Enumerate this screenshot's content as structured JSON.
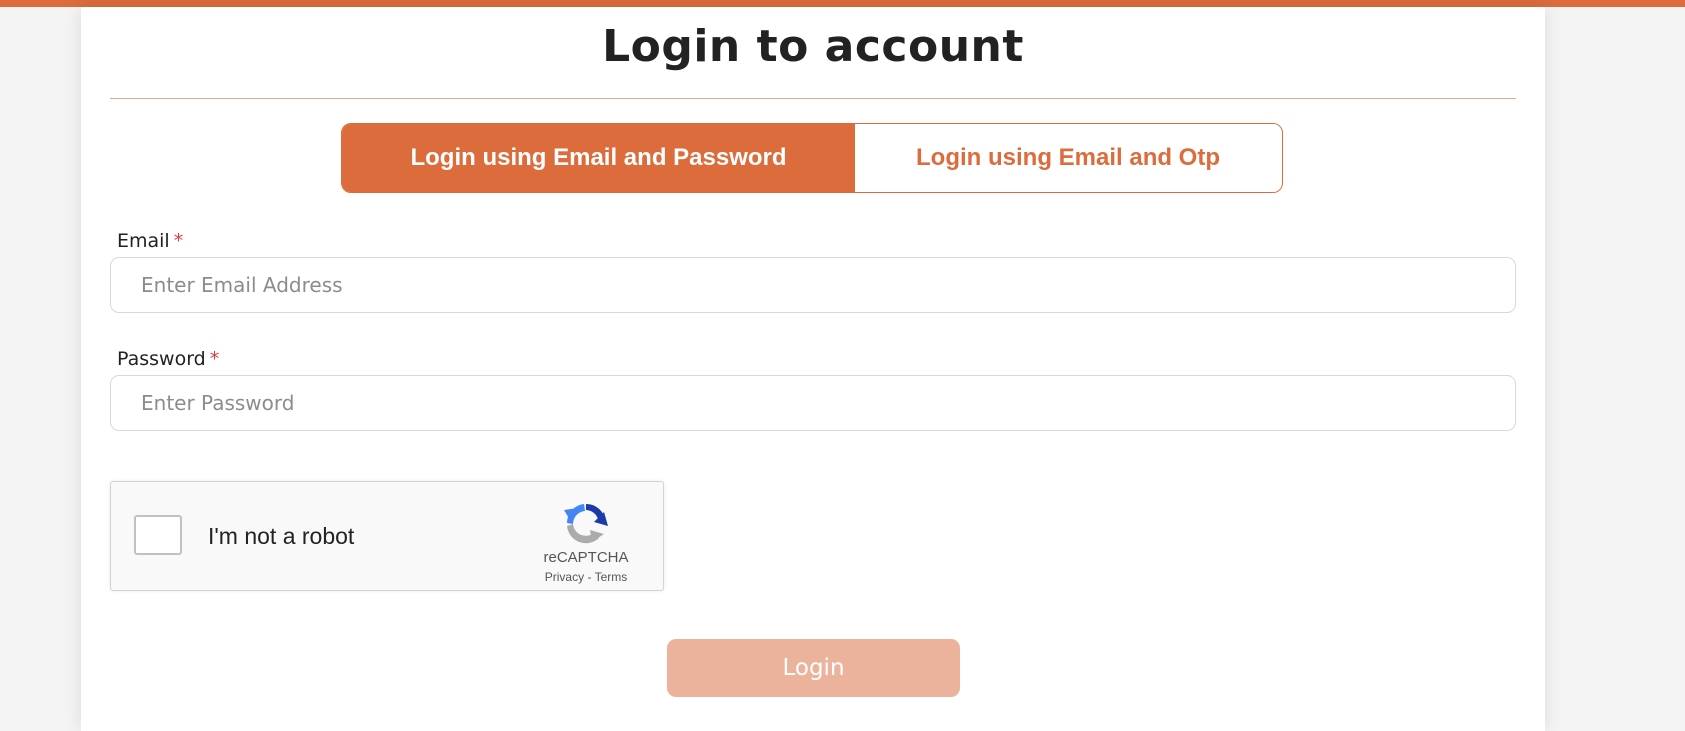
{
  "page": {
    "title": "Login to account"
  },
  "tabs": [
    {
      "label": "Login using Email and Password",
      "active": true
    },
    {
      "label": "Login using Email and Otp",
      "active": false
    }
  ],
  "form": {
    "email": {
      "label": "Email",
      "required_marker": "*",
      "placeholder": "Enter Email Address",
      "value": ""
    },
    "password": {
      "label": "Password",
      "required_marker": "*",
      "placeholder": "Enter Password",
      "value": ""
    },
    "captcha": {
      "label": "I'm not a robot",
      "brand": "reCAPTCHA",
      "privacy_label": "Privacy",
      "separator": " - ",
      "terms_label": "Terms",
      "checked": false,
      "icon": "recaptcha-logo-icon"
    },
    "submit_label": "Login"
  },
  "colors": {
    "accent": "#dc6c3c",
    "button_disabled": "#ecb39c",
    "required": "#e03a3a"
  }
}
